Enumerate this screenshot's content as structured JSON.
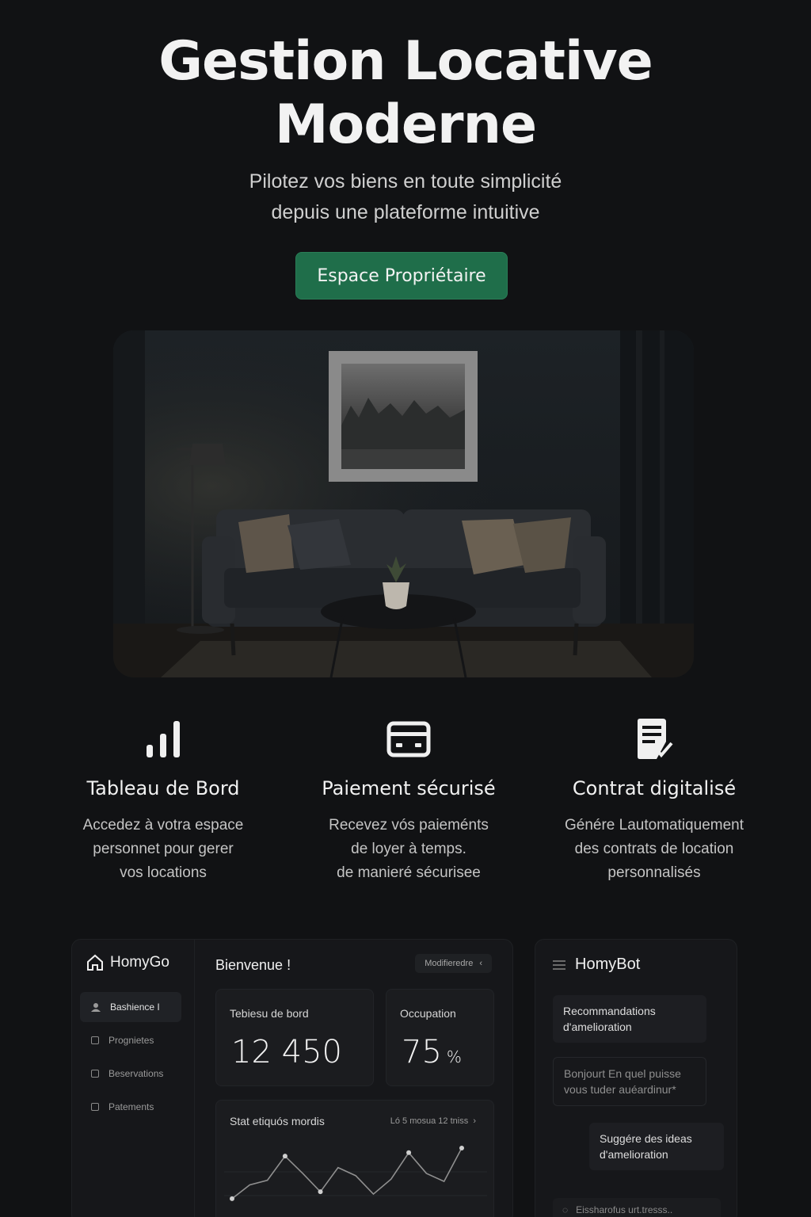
{
  "hero": {
    "title_line1": "Gestion Locative",
    "title_line2": "Moderne",
    "subtitle_line1": "Pilotez vos biens en toute simplicité",
    "subtitle_line2": "depuis une plateforme intuitive",
    "cta_label": "Espace Propriétaire"
  },
  "features": [
    {
      "icon": "bar-chart-icon",
      "title": "Tableau de Bord",
      "lines": [
        "Accedez à votra espace",
        "personnet pour gerer",
        "vos locations"
      ]
    },
    {
      "icon": "card-icon",
      "title": "Paiement sécurisé",
      "lines": [
        "Recevez vós paieménts",
        "de loyer à temps.",
        "de manieré sécurisee"
      ]
    },
    {
      "icon": "contract-check-icon",
      "title": "Contrat digitalisé",
      "lines": [
        "Génére Lautomatiquement",
        "des contrats de location",
        "personnalisés"
      ]
    }
  ],
  "dashboard": {
    "brand": "HomyGo",
    "nav": [
      "Bashience I",
      "Prognietes",
      "Beservations",
      "Patements"
    ],
    "welcome": "Bienvenue !",
    "modify_label": "Modifieredre",
    "card1_label": "Tebiesu de bord",
    "card1_value": "12 450",
    "card2_label": "Occupation",
    "card2_value": "75",
    "card2_unit": "%",
    "chart_label": "Stat etiquós mordis",
    "chart_meta": "Ló 5 mosua 12 tniss",
    "chart_points": [
      18,
      30,
      34,
      55,
      40,
      24,
      45,
      38,
      22,
      35,
      58,
      40,
      33,
      62
    ]
  },
  "bot": {
    "title": "HomyBot",
    "msg1": "Recommandations d'amelioration",
    "msg2": "Bonjourt En quel puisse vous tuder auéardinur*",
    "msg3": "Suggére des ideas d'amelioration",
    "input_placeholder": "Eissharofus urt.tresss.."
  },
  "colors": {
    "accent": "#1f6e4a",
    "background": "#111214"
  }
}
